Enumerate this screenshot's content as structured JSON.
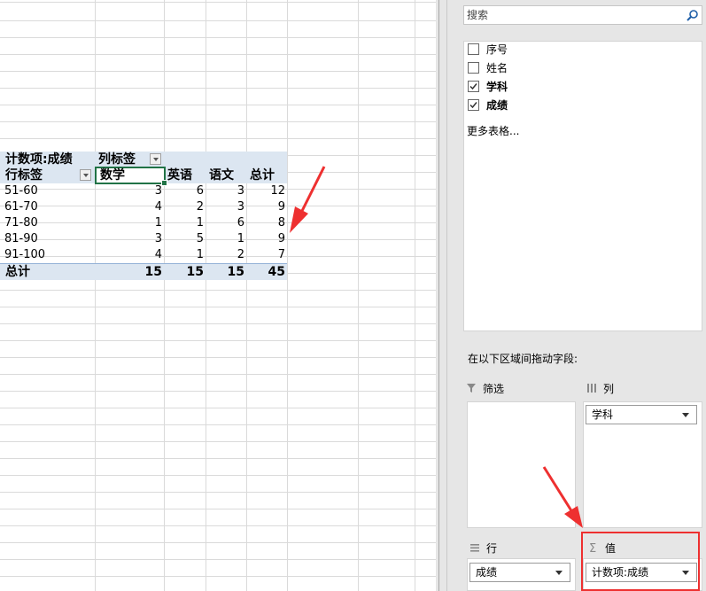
{
  "pivot": {
    "value_caption": "计数项:成绩",
    "column_caption": "列标签",
    "row_caption": "行标签",
    "columns": [
      "数学",
      "英语",
      "语文",
      "总计"
    ],
    "rows": [
      {
        "label": "51-60",
        "values": [
          "3",
          "6",
          "3",
          "12"
        ]
      },
      {
        "label": "61-70",
        "values": [
          "4",
          "2",
          "3",
          "9"
        ]
      },
      {
        "label": "71-80",
        "values": [
          "1",
          "1",
          "6",
          "8"
        ]
      },
      {
        "label": "81-90",
        "values": [
          "3",
          "5",
          "1",
          "9"
        ]
      },
      {
        "label": "91-100",
        "values": [
          "4",
          "1",
          "2",
          "7"
        ]
      }
    ],
    "total": {
      "label": "总计",
      "values": [
        "15",
        "15",
        "15",
        "45"
      ]
    }
  },
  "field_pane": {
    "search_placeholder": "搜索",
    "fields": [
      {
        "label": "序号",
        "checked": false
      },
      {
        "label": "姓名",
        "checked": false
      },
      {
        "label": "学科",
        "checked": true
      },
      {
        "label": "成绩",
        "checked": true
      }
    ],
    "more_tables": "更多表格...",
    "drag_hint": "在以下区域间拖动字段:",
    "areas": {
      "filters": {
        "title": "筛选"
      },
      "columns": {
        "title": "列",
        "item": "学科"
      },
      "rows": {
        "title": "行",
        "item": "成绩"
      },
      "values": {
        "title": "值",
        "item": "计数项:成绩"
      }
    }
  },
  "colors": {
    "annotation": "#ee3030",
    "pivot_header_bg": "#dce6f1",
    "active_cell_border": "#217346"
  },
  "icons": [
    "search-icon",
    "filter-icon",
    "columns-icon",
    "rows-icon",
    "sigma-icon",
    "dropdown-arrow-icon",
    "checkbox-icon"
  ]
}
